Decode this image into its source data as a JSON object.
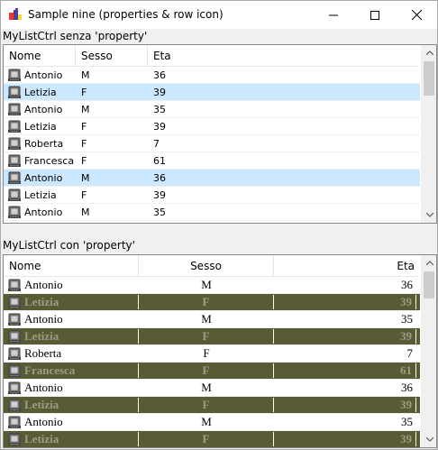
{
  "window": {
    "title": "Sample nine (properties & row icon)",
    "icon": "app-icon"
  },
  "list1": {
    "label": "MyListCtrl senza 'property'",
    "columns": [
      "Nome",
      "Sesso",
      "Eta"
    ],
    "rows": [
      {
        "name": "Antonio",
        "sex": "M",
        "age": "36",
        "selected": false
      },
      {
        "name": "Letizia",
        "sex": "F",
        "age": "39",
        "selected": true
      },
      {
        "name": "Antonio",
        "sex": "M",
        "age": "35",
        "selected": false
      },
      {
        "name": "Letizia",
        "sex": "F",
        "age": "39",
        "selected": false
      },
      {
        "name": "Roberta",
        "sex": "F",
        "age": "7",
        "selected": false
      },
      {
        "name": "Francesca",
        "sex": "F",
        "age": "61",
        "selected": false
      },
      {
        "name": "Antonio",
        "sex": "M",
        "age": "36",
        "selected": true
      },
      {
        "name": "Letizia",
        "sex": "F",
        "age": "39",
        "selected": false
      },
      {
        "name": "Antonio",
        "sex": "M",
        "age": "35",
        "selected": false
      }
    ],
    "row_icon": "notebook-icon",
    "selection_color": "#cce8ff"
  },
  "list2": {
    "label": "MyListCtrl con 'property'",
    "columns": [
      "Nome",
      "Sesso",
      "Eta"
    ],
    "rows": [
      {
        "name": "Antonio",
        "sex": "M",
        "age": "36",
        "alt": false
      },
      {
        "name": "Letizia",
        "sex": "F",
        "age": "39",
        "alt": true
      },
      {
        "name": "Antonio",
        "sex": "M",
        "age": "35",
        "alt": false
      },
      {
        "name": "Letizia",
        "sex": "F",
        "age": "39",
        "alt": true
      },
      {
        "name": "Roberta",
        "sex": "F",
        "age": "7",
        "alt": false
      },
      {
        "name": "Francesca",
        "sex": "F",
        "age": "61",
        "alt": true
      },
      {
        "name": "Antonio",
        "sex": "M",
        "age": "36",
        "alt": false
      },
      {
        "name": "Letizia",
        "sex": "F",
        "age": "39",
        "alt": true
      },
      {
        "name": "Antonio",
        "sex": "M",
        "age": "35",
        "alt": false
      },
      {
        "name": "Letizia",
        "sex": "F",
        "age": "39",
        "alt": true
      }
    ],
    "alt_row_bg": "#585b33",
    "alt_row_text": "#9c9c87"
  }
}
